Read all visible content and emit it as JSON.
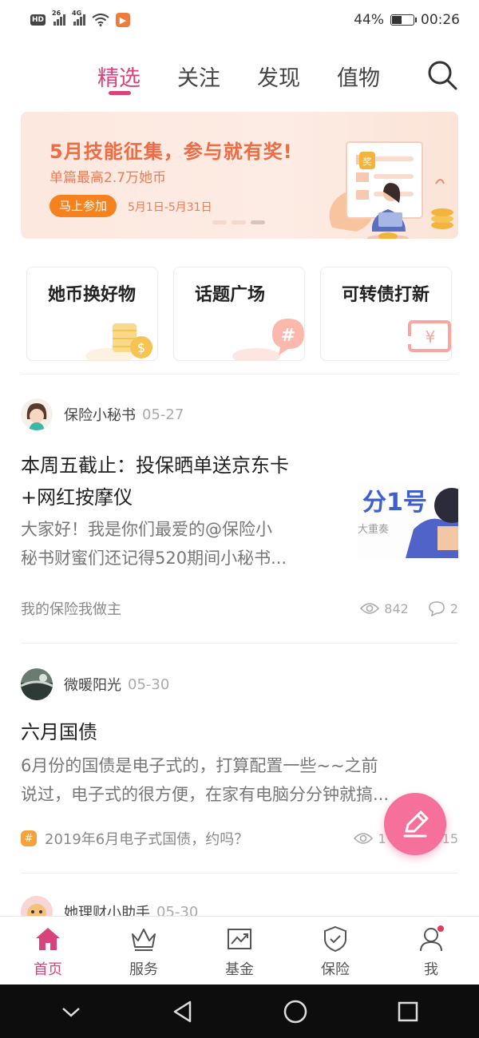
{
  "status_bar": {
    "signal1": "26",
    "signal2": "4G",
    "battery": "44%",
    "battery_level": 0.44,
    "time": "00:26"
  },
  "top_tabs": [
    "精选",
    "关注",
    "发现",
    "值物"
  ],
  "active_tab": "精选",
  "banner": {
    "title": "5月技能征集，参与就有奖!",
    "subtitle": "单篇最高2.7万她币",
    "cta": "马上参加",
    "dates": "5月1日-5月31日",
    "badge": "奖",
    "active_dot": 3
  },
  "quick_cards": [
    {
      "label": "她币换好物",
      "icon": "coin-stack-icon"
    },
    {
      "label": "话题广场",
      "icon": "hashtag-bubble-icon"
    },
    {
      "label": "可转债打新",
      "icon": "yuan-ticket-icon"
    }
  ],
  "posts": [
    {
      "author": "保险小秘书",
      "date": "05-27",
      "title_lines": [
        "本周五截止：投保晒单送京东卡",
        "+网红按摩仪"
      ],
      "body_lines": [
        "大家好！我是你们最爱的@保险小",
        "秘书财蜜们还记得520期间小秘书..."
      ],
      "thumb_text": "分1号",
      "thumb_sub": "大重奏",
      "topic": "我的保险我做主",
      "views": "842",
      "comments": "2"
    },
    {
      "author": "微暖阳光",
      "date": "05-30",
      "title_lines": [
        "六月国债"
      ],
      "body_lines": [
        "6月份的国债是电子式的，打算配置一些~~之前",
        "说过，电子式的很方便，在家有电脑分分钟就搞..."
      ],
      "topic": "2019年6月电子式国债，约吗？",
      "views": "1",
      "comments": "15"
    },
    {
      "author": "她理财小助手",
      "date": "05-30"
    }
  ],
  "bottom_nav": [
    {
      "label": "首页",
      "icon": "home-icon",
      "active": true
    },
    {
      "label": "服务",
      "icon": "crown-icon",
      "active": false
    },
    {
      "label": "基金",
      "icon": "chart-icon",
      "active": false
    },
    {
      "label": "保险",
      "icon": "shield-icon",
      "active": false
    },
    {
      "label": "我",
      "icon": "user-icon",
      "active": false
    }
  ],
  "colors": {
    "accent": "#d9437b",
    "fab": "#f5709a",
    "banner_text": "#ef6b44",
    "cta": "#f6821f"
  }
}
